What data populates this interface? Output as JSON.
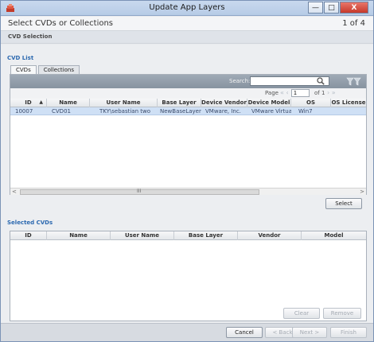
{
  "window": {
    "title": "Update App Layers",
    "minimize": "—",
    "maximize": "□",
    "close": "X"
  },
  "header": {
    "title": "Select CVDs or Collections",
    "step": "1 of 4"
  },
  "subheader": {
    "label": "CVD Selection"
  },
  "cvd_list": {
    "section_label": "CVD List",
    "tabs": [
      {
        "label": "CVDs"
      },
      {
        "label": "Collections"
      }
    ],
    "search": {
      "label": "Search:",
      "value": ""
    },
    "pager": {
      "page_label": "Page",
      "page_value": "1",
      "of_label": "of 1",
      "prev": "« ‹",
      "next": "› »"
    },
    "columns": [
      "ID",
      "Name",
      "User Name",
      "Base Layer",
      "Device Vendor",
      "Device Model",
      "OS",
      "OS License"
    ],
    "rows": [
      {
        "id": "10007",
        "name": "CVD01",
        "user": "TKY\\sebastian two",
        "base_layer": "NewBaseLayer...",
        "vendor": "VMware, Inc.",
        "model": "VMware Virtua...",
        "os": "Win7",
        "license": ""
      }
    ],
    "sort_glyph": "▲",
    "scroll": {
      "left": "<",
      "grip": "III",
      "right": ">"
    },
    "select_button": "Select"
  },
  "selected": {
    "section_label": "Selected CVDs",
    "columns": [
      "ID",
      "Name",
      "User Name",
      "Base Layer",
      "Vendor",
      "Model"
    ],
    "clear_button": "Clear",
    "remove_button": "Remove"
  },
  "footer": {
    "cancel": "Cancel",
    "back": "< Back",
    "next": "Next >",
    "finish": "Finish"
  },
  "colors": {
    "accent": "#2c69b0",
    "selection": "#cfe0f5",
    "close": "#c6392b"
  },
  "icons": {
    "search": "magnifier",
    "filter": "funnel",
    "app": "app-layer-icon"
  }
}
